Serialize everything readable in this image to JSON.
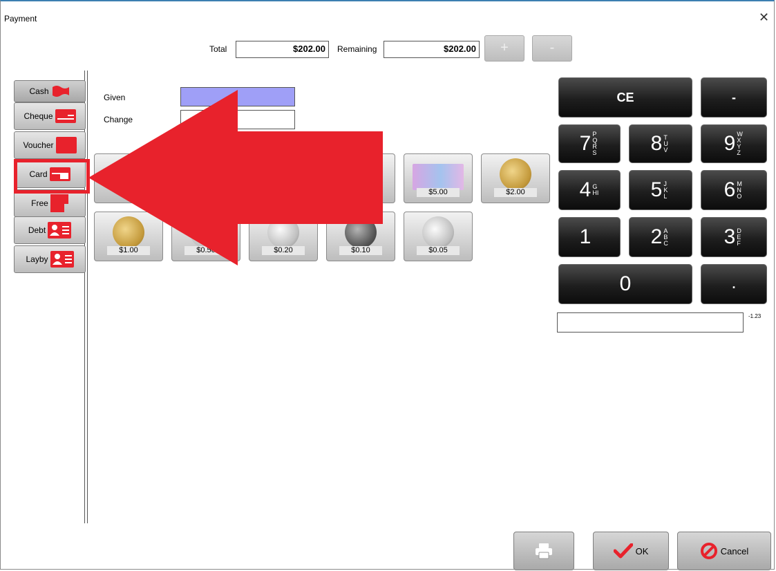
{
  "window": {
    "title": "Payment",
    "close_symbol": "✕"
  },
  "summary": {
    "total_label": "Total",
    "total_value": "$202.00",
    "remaining_label": "Remaining",
    "remaining_value": "$202.00",
    "add_symbol": "+",
    "minus_symbol": "-"
  },
  "tabs": [
    {
      "label": "Cash",
      "icon": "cash-icon"
    },
    {
      "label": "Cheque",
      "icon": "cheque-icon"
    },
    {
      "label": "Voucher",
      "icon": "voucher-icon"
    },
    {
      "label": "Card",
      "icon": "card-icon"
    },
    {
      "label": "Free",
      "icon": "free-icon"
    },
    {
      "label": "Debt",
      "icon": "contact-card-icon"
    },
    {
      "label": "Layby",
      "icon": "contact-card-icon"
    }
  ],
  "tendered": {
    "given_label": "Given",
    "change_label": "Change",
    "given_color": "#9f9ff7"
  },
  "denominations_row1": [
    {
      "label": "$5.00",
      "kind": "note"
    },
    {
      "label": "$2.00",
      "kind": "gold-coin"
    }
  ],
  "denominations_row2": [
    {
      "label": "$1.00",
      "kind": "gold-coin"
    },
    {
      "label": "$0.50",
      "kind": "silver-coin"
    },
    {
      "label": "$0.20",
      "kind": "silver-coin"
    },
    {
      "label": "$0.10",
      "kind": "dark-coin"
    },
    {
      "label": "$0.05",
      "kind": "silver-coin"
    }
  ],
  "keypad": {
    "ce": "CE",
    "minus": "-",
    "keys": [
      {
        "digit": "7",
        "letters": "PQRS"
      },
      {
        "digit": "8",
        "letters": "TUV"
      },
      {
        "digit": "9",
        "letters": "WXYZ"
      },
      {
        "digit": "4",
        "letters": "GHI"
      },
      {
        "digit": "5",
        "letters": "JKL"
      },
      {
        "digit": "6",
        "letters": "MNO"
      },
      {
        "digit": "1",
        "letters": ""
      },
      {
        "digit": "2",
        "letters": "ABC"
      },
      {
        "digit": "3",
        "letters": "DEF"
      }
    ],
    "zero": "0",
    "dot": "."
  },
  "entry": {
    "sub_label": "-1.23"
  },
  "buttons": {
    "print_icon": "printer-icon",
    "ok_label": "OK",
    "cancel_label": "Cancel"
  },
  "overlay": {
    "arrow_color": "#e8222c",
    "highlight_color": "#e8222c"
  }
}
